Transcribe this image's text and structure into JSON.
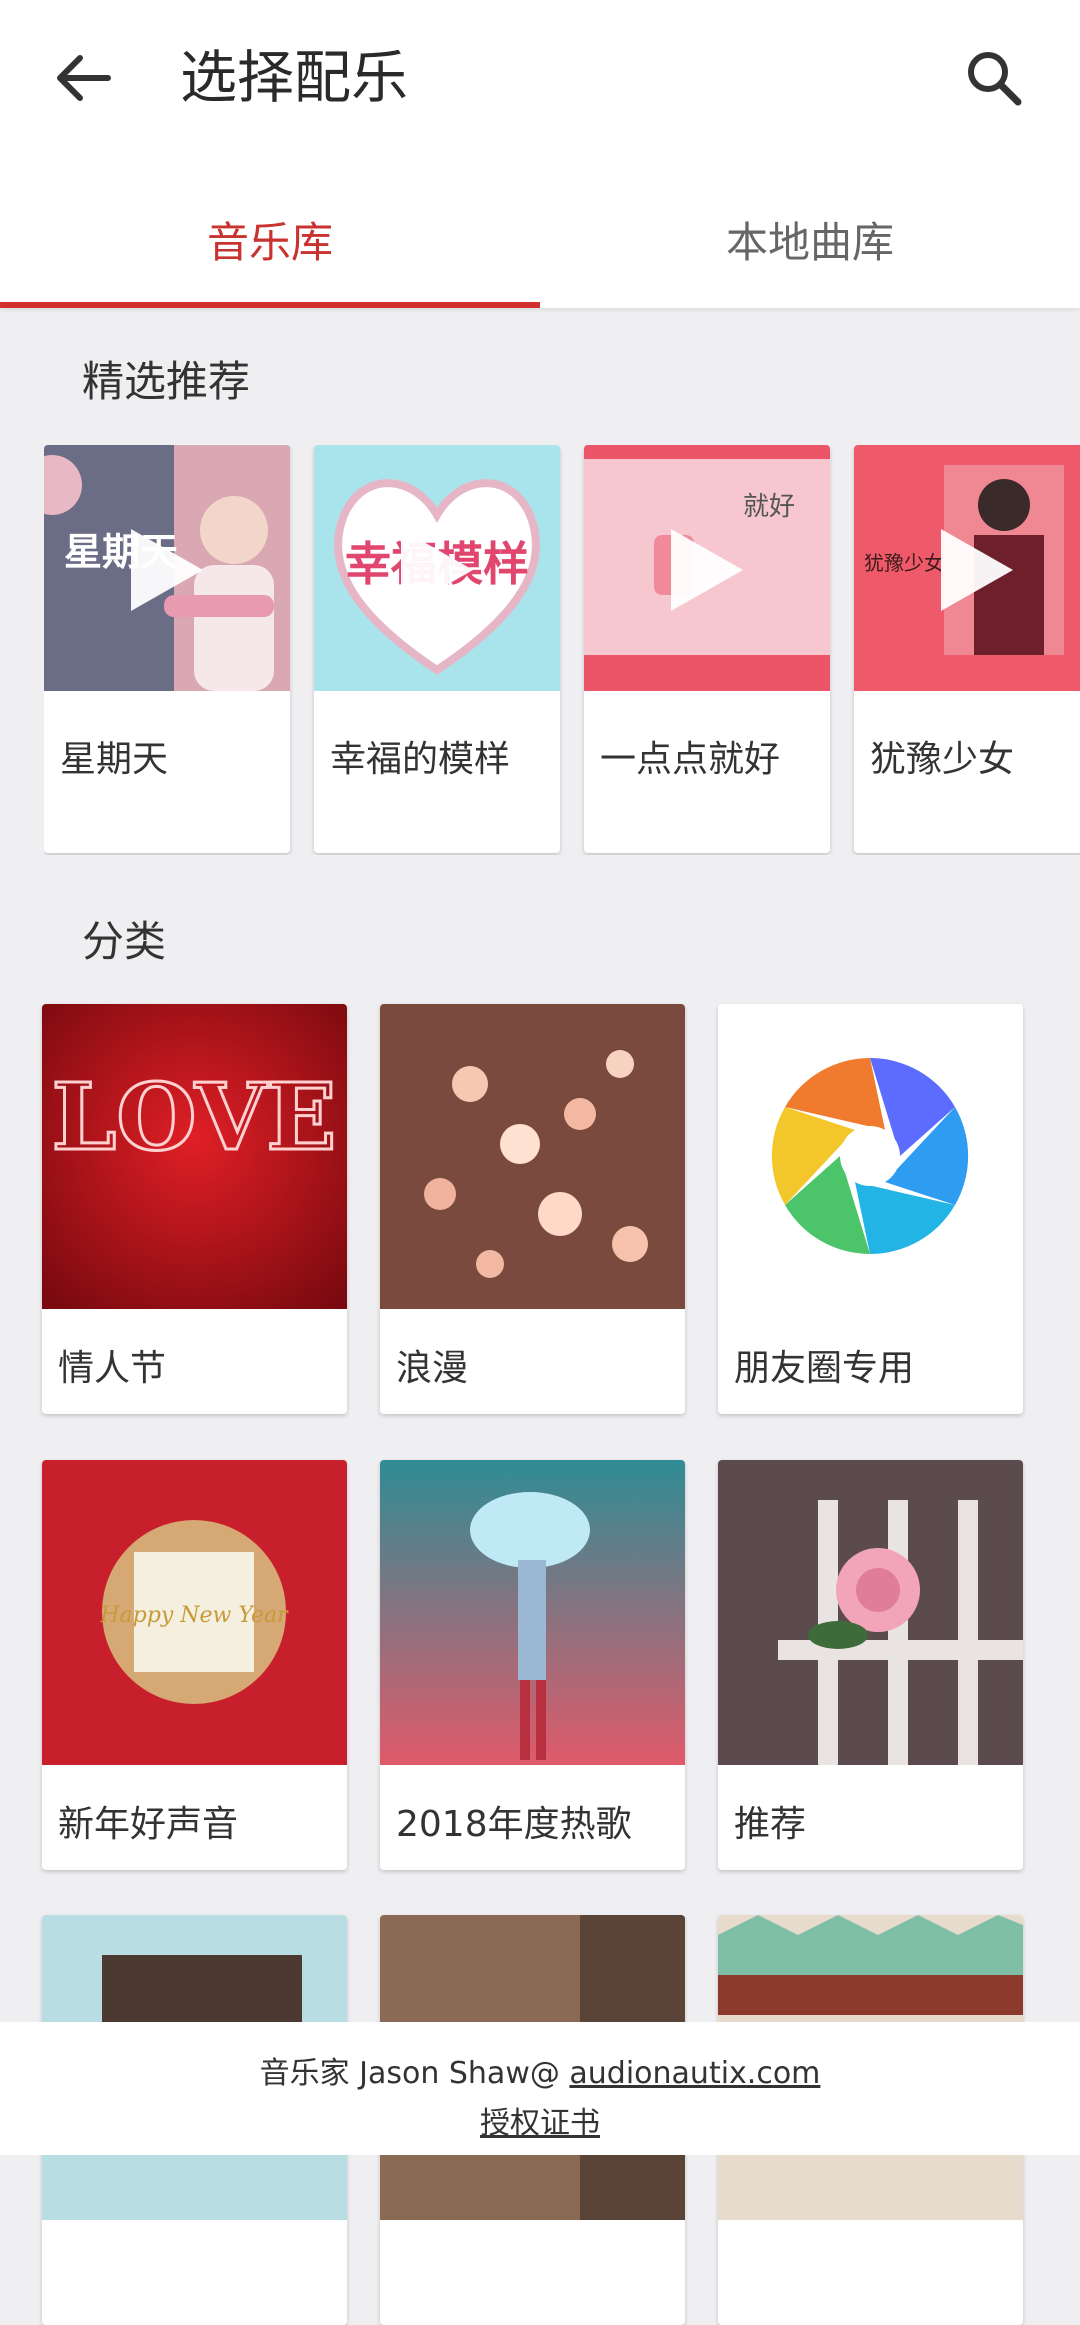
{
  "header": {
    "title": "选择配乐",
    "back_icon": "arrow-back-icon",
    "search_icon": "search-icon"
  },
  "tabs": [
    {
      "label": "音乐库",
      "active": true
    },
    {
      "label": "本地曲库",
      "active": false
    }
  ],
  "featured": {
    "title": "精选推荐",
    "items": [
      {
        "title": "星期天",
        "cover_text": "星期天"
      },
      {
        "title": "幸福的模样",
        "cover_text": "幸福模样"
      },
      {
        "title": "一点点就好",
        "cover_text": "就好"
      },
      {
        "title": "犹豫少女",
        "cover_text": "犹豫少女"
      }
    ]
  },
  "categories": {
    "title": "分类",
    "items": [
      {
        "title": "情人节",
        "cover_text": "LOVE"
      },
      {
        "title": "浪漫"
      },
      {
        "title": "朋友圈专用"
      },
      {
        "title": "新年好声音",
        "cover_text": "Happy New Year"
      },
      {
        "title": "2018年度热歌"
      },
      {
        "title": "推荐"
      },
      {
        "title": ""
      },
      {
        "title": ""
      },
      {
        "title": ""
      }
    ]
  },
  "footer": {
    "credit_prefix": "音乐家 Jason Shaw@ ",
    "credit_link": "audionautix.com",
    "license": "授权证书"
  },
  "colors": {
    "accent": "#d2302e",
    "background": "#efeef1"
  }
}
